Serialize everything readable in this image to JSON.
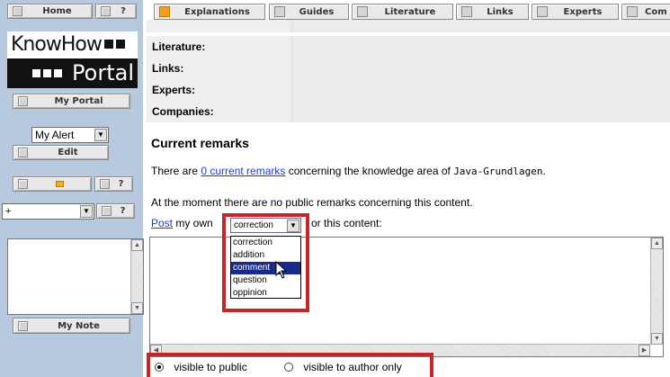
{
  "sidebar": {
    "home_label": "Home",
    "help_label": "?",
    "logo_line1": "KnowHow",
    "logo_line2": "Portal",
    "my_portal_label": "My Portal",
    "alert_select_value": "My Alert",
    "edit_label": "Edit",
    "help2_label": "?",
    "plus_select_value": "+",
    "help3_label": "?",
    "my_note_label": "My Note"
  },
  "nav": {
    "tabs": [
      {
        "label": "Explanations"
      },
      {
        "label": "Guides"
      },
      {
        "label": "Literature"
      },
      {
        "label": "Links"
      },
      {
        "label": "Experts"
      },
      {
        "label": "Com"
      }
    ]
  },
  "rows": [
    {
      "label": "Literature:"
    },
    {
      "label": "Links:"
    },
    {
      "label": "Experts:"
    },
    {
      "label": "Companies:"
    }
  ],
  "remarks": {
    "heading": "Current remarks",
    "line1_pre": "There are ",
    "line1_link": "0 current remarks",
    "line1_mid": " concerning the knowledge area of ",
    "line1_topic": "Java-Grundlagen",
    "line1_end": ".",
    "line2": "At the moment there are no public remarks concerning this content",
    "line2_end": ".",
    "post_link": "Post",
    "post_mid": " my own",
    "post_end": "or this content:"
  },
  "remark_type": {
    "selected": "correction",
    "options": [
      "correction",
      "addition",
      "comment",
      "question",
      "oppinion"
    ],
    "highlighted": "comment"
  },
  "visibility": {
    "public_label": "visible to public",
    "author_label": "visible to author only",
    "selected": "public"
  },
  "colors": {
    "sidebar_bg": "#b7c9df",
    "link": "#1f3bd1",
    "highlight_frame": "#c8222a",
    "active_tab_marker": "#f3a018"
  }
}
